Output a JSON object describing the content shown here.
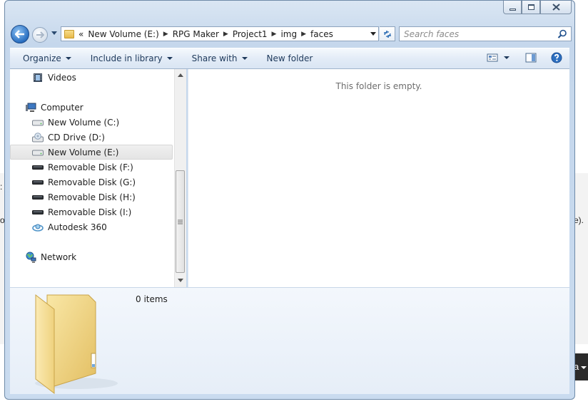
{
  "background": {
    "left_fragment_1": ":",
    "left_fragment_2": "o",
    "right_fragment": "e).",
    "dark_fragment": "a"
  },
  "window": {
    "caption": {
      "minimize_icon": "minimize-icon",
      "maximize_icon": "maximize-icon",
      "close_icon": "close-icon"
    },
    "navigation": {
      "back_icon": "back-arrow-icon",
      "forward_icon": "forward-arrow-icon",
      "address": {
        "overflow": "«",
        "crumbs": [
          "New Volume (E:)",
          "RPG Maker",
          "Project1",
          "img",
          "faces"
        ]
      },
      "refresh_icon": "refresh-icon",
      "search": {
        "placeholder": "Search faces",
        "icon": "magnifier-icon"
      }
    },
    "toolbar": {
      "organize": "Organize",
      "include_in_library": "Include in library",
      "share_with": "Share with",
      "new_folder": "New folder",
      "views_icon": "views-icon",
      "preview_pane_icon": "preview-pane-icon",
      "help_icon": "help-icon"
    },
    "nav_pane": {
      "items": [
        {
          "label": "Videos",
          "icon": "videos-icon"
        },
        {
          "label": "Computer",
          "icon": "computer-icon"
        },
        {
          "label": "New Volume (C:)",
          "icon": "drive-icon"
        },
        {
          "label": "CD Drive (D:)",
          "icon": "cd-drive-icon"
        },
        {
          "label": "New Volume (E:)",
          "icon": "drive-icon",
          "selected": true
        },
        {
          "label": "Removable Disk (F:)",
          "icon": "removable-disk-icon"
        },
        {
          "label": "Removable Disk (G:)",
          "icon": "removable-disk-icon"
        },
        {
          "label": "Removable Disk (H:)",
          "icon": "removable-disk-icon"
        },
        {
          "label": "Removable Disk (I:)",
          "icon": "removable-disk-icon"
        },
        {
          "label": "Autodesk 360",
          "icon": "autodesk-360-icon"
        },
        {
          "label": "Network",
          "icon": "network-icon"
        }
      ]
    },
    "content": {
      "empty_message": "This folder is empty."
    },
    "details_pane": {
      "item_count": "0 items",
      "icon": "folder-icon"
    },
    "colors": {
      "accent": "#1e395b",
      "selection": "#e4e4e4",
      "toolbar": "#dce7f4"
    }
  }
}
